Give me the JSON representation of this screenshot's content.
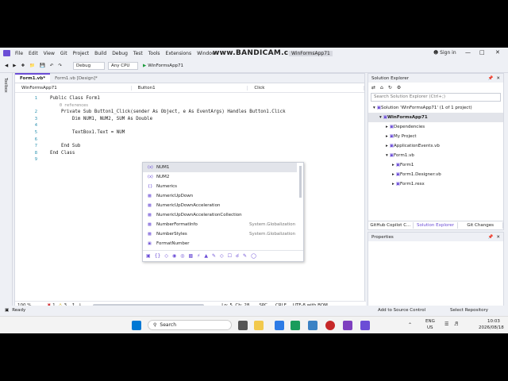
{
  "window": {
    "title": "WinFormsApp71",
    "watermark": "www.BANDICAM.com",
    "signin": "Sign in"
  },
  "menu": [
    "File",
    "Edit",
    "View",
    "Git",
    "Project",
    "Build",
    "Debug",
    "Test",
    "Tools",
    "Extensions",
    "Window"
  ],
  "toolbar": {
    "config": "Debug",
    "platform": "Any CPU",
    "run": "WinFormsApp71"
  },
  "tabs": [
    {
      "label": "Form1.vb*"
    },
    {
      "label": "Form1.vb [Design]*"
    }
  ],
  "side_tab": "Toolbox",
  "navbar": {
    "project": "WinFormsApp71",
    "object": "Button1",
    "event": "Click"
  },
  "code": {
    "lines": [
      {
        "n": "1",
        "t": "Public Class Form1"
      },
      {
        "n": "",
        "t": "    0 references"
      },
      {
        "n": "2",
        "t": "    Private Sub Button1_Click(sender As Object, e As EventArgs) Handles Button1.Click"
      },
      {
        "n": "3",
        "t": "        Dim NUM1, NUM2, SUM As Double"
      },
      {
        "n": "4",
        "t": ""
      },
      {
        "n": "5",
        "t": "        TextBox1.Text = NUM"
      },
      {
        "n": "6",
        "t": ""
      },
      {
        "n": "7",
        "t": "    End Sub"
      },
      {
        "n": "8",
        "t": "End Class"
      },
      {
        "n": "9",
        "t": ""
      }
    ]
  },
  "autocomplete": {
    "items": [
      {
        "label": "NUM1",
        "ns": ""
      },
      {
        "label": "NUM2",
        "ns": ""
      },
      {
        "label": "Numerics",
        "ns": ""
      },
      {
        "label": "NumericUpDown",
        "ns": ""
      },
      {
        "label": "NumericUpDownAcceleration",
        "ns": ""
      },
      {
        "label": "NumericUpDownAccelerationCollection",
        "ns": ""
      },
      {
        "label": "NumberFormatInfo",
        "ns": "System.Globalization"
      },
      {
        "label": "NumberStyles",
        "ns": "System.Globalization"
      },
      {
        "label": "FormatNumber",
        "ns": ""
      }
    ]
  },
  "editor_status": {
    "zoom": "100 %",
    "errors": "1",
    "warnings": "3",
    "position": "Ln: 5, Ch: 28",
    "spc": "SPC",
    "crlf": "CRLF",
    "encoding": "UTF-8 with BOM"
  },
  "solution": {
    "title": "Solution Explorer",
    "search": "Search Solution Explorer (Ctrl+;)",
    "items": [
      {
        "label": "Solution 'WinFormsApp71' (1 of 1 project)",
        "indent": 0
      },
      {
        "label": "WinFormsApp71",
        "indent": 1
      },
      {
        "label": "Dependencies",
        "indent": 2
      },
      {
        "label": "My Project",
        "indent": 2
      },
      {
        "label": "ApplicationEvents.vb",
        "indent": 2
      },
      {
        "label": "Form1.vb",
        "indent": 2
      },
      {
        "label": "Form1",
        "indent": 3
      },
      {
        "label": "Form1.Designer.vb",
        "indent": 3
      },
      {
        "label": "Form1.resx",
        "indent": 3
      }
    ],
    "bottom_tabs": [
      "GitHub Copilot C...",
      "Solution Explorer",
      "Git Changes"
    ]
  },
  "properties": {
    "title": "Properties"
  },
  "statusbar": {
    "ready": "Ready",
    "source": "Add to Source Control",
    "repo": "Select Repository"
  },
  "taskbar": {
    "search": "Search",
    "lang": "ENG",
    "region": "US",
    "time": "10:03",
    "date": "2026/08/18"
  }
}
